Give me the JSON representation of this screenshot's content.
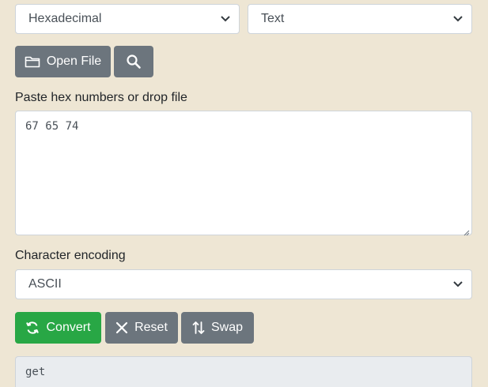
{
  "converter": {
    "from_select": {
      "value": "Hexadecimal",
      "icon": "chevron-down-icon"
    },
    "to_select": {
      "value": "Text",
      "icon": "chevron-down-icon"
    }
  },
  "toolbar": {
    "open_file_label": "Open File",
    "open_file_icon": "folder-icon",
    "search_icon": "search-icon"
  },
  "input": {
    "label": "Paste hex numbers or drop file",
    "value": "67 65 74"
  },
  "encoding": {
    "label": "Character encoding",
    "value": "ASCII",
    "icon": "chevron-down-icon"
  },
  "actions": {
    "convert_label": "Convert",
    "convert_icon": "refresh-icon",
    "reset_label": "Reset",
    "reset_icon": "close-icon",
    "swap_label": "Swap",
    "swap_icon": "swap-icon"
  },
  "output": {
    "value": "get"
  },
  "colors": {
    "background": "#EEE6D4",
    "gray_button": "#6c757d",
    "green_button": "#28a745",
    "output_background": "#e9ecef"
  }
}
